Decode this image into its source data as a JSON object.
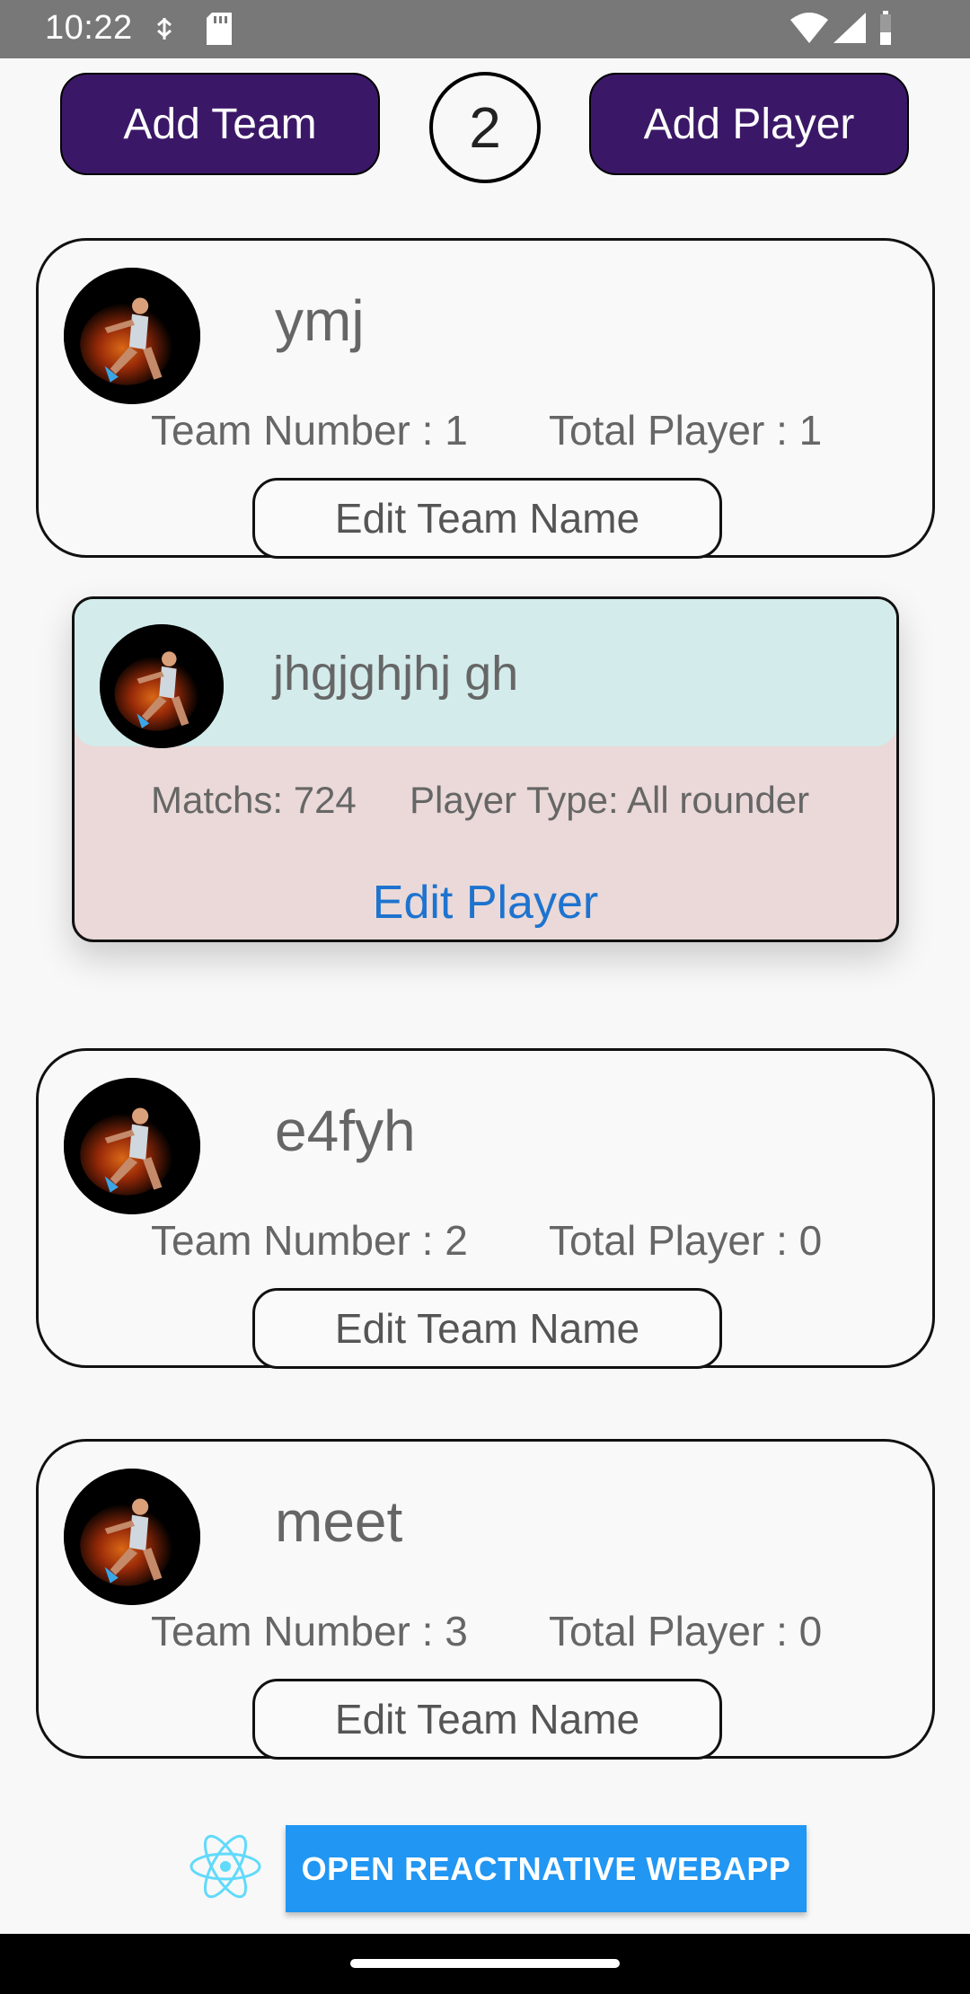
{
  "status_bar": {
    "time": "10:22",
    "icons": [
      "usb-debug-icon",
      "sd-card-icon",
      "wifi-icon",
      "signal-icon",
      "battery-icon"
    ]
  },
  "header": {
    "add_team_label": "Add Team",
    "team_count": "2",
    "add_player_label": "Add Player"
  },
  "teams": [
    {
      "name": "ymj",
      "team_number": "Team Number : 1",
      "total_player": "Total Player : 1",
      "edit_label": "Edit Team Name"
    },
    {
      "name": "e4fyh",
      "team_number": "Team Number : 2",
      "total_player": "Total Player : 0",
      "edit_label": "Edit Team Name"
    },
    {
      "name": "meet",
      "team_number": "Team Number : 3",
      "total_player": "Total Player : 0",
      "edit_label": "Edit Team Name"
    }
  ],
  "player": {
    "name": "jhgjghjhj gh",
    "matches": "Matchs: 724",
    "player_type": "Player Type: All rounder",
    "edit_label": "Edit Player"
  },
  "footer": {
    "open_webapp_label": "OPEN REACTNATIVE WEBAPP"
  },
  "colors": {
    "primary_button": "#3b1867",
    "player_header": "#d3ebeb",
    "player_body": "#ead9d8",
    "link": "#1e73cf",
    "webapp_button": "#2196f3"
  }
}
